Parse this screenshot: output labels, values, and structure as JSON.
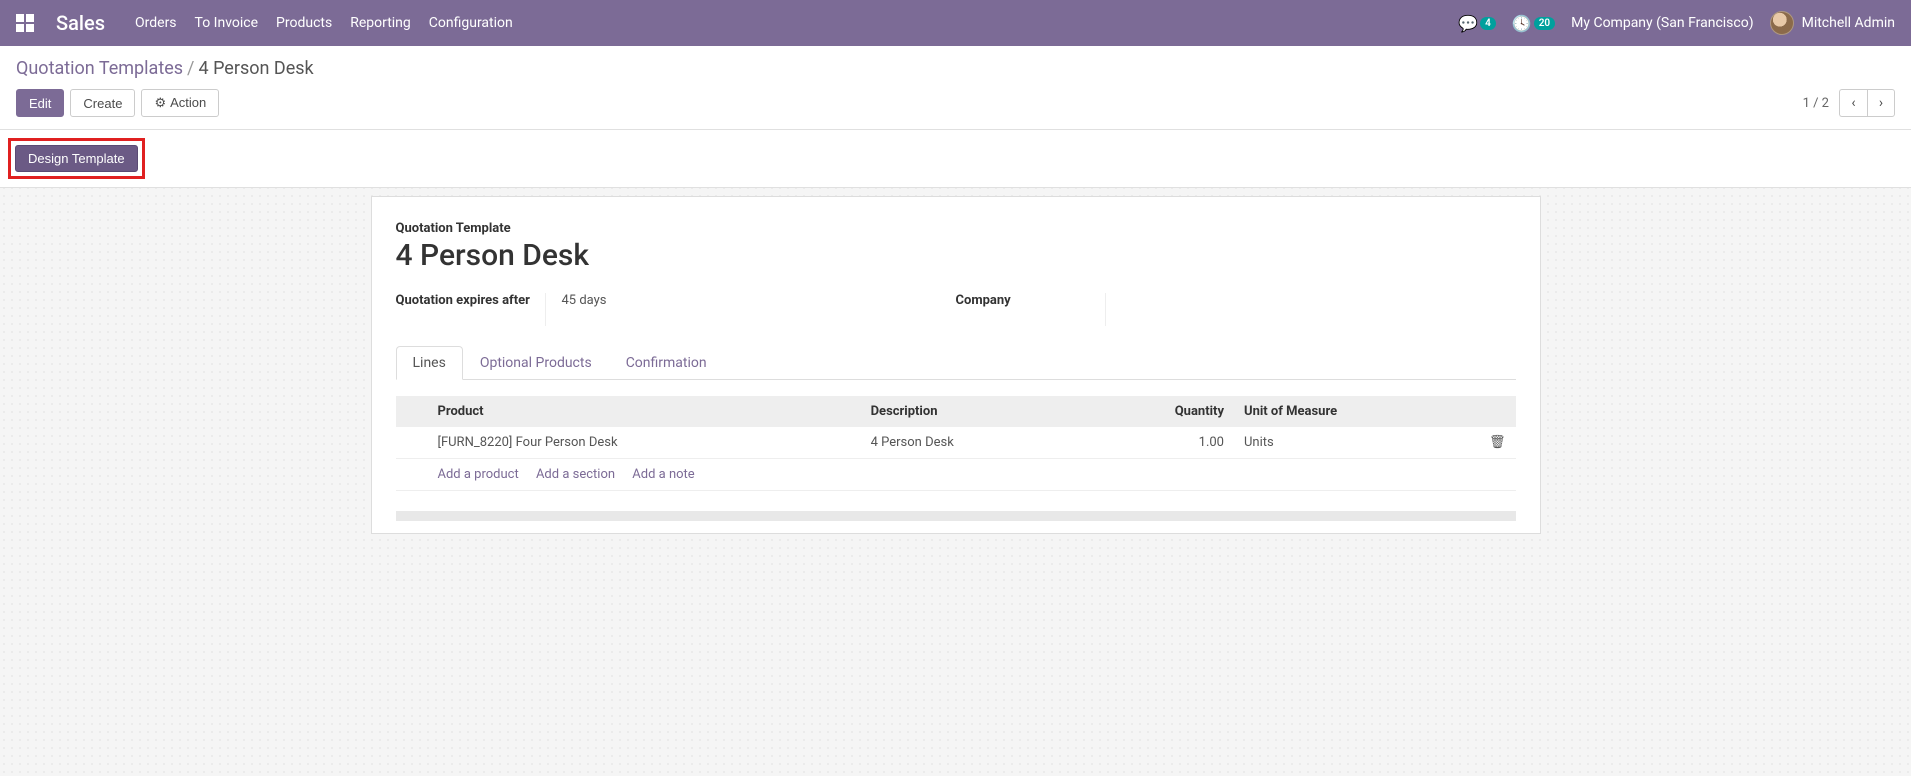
{
  "navbar": {
    "brand": "Sales",
    "menu": [
      "Orders",
      "To Invoice",
      "Products",
      "Reporting",
      "Configuration"
    ],
    "msg_badge": "4",
    "activity_badge": "20",
    "company": "My Company (San Francisco)",
    "user": "Mitchell Admin"
  },
  "breadcrumb": {
    "parent": "Quotation Templates",
    "current": "4 Person Desk"
  },
  "buttons": {
    "edit": "Edit",
    "create": "Create",
    "action": "Action",
    "design_template": "Design Template"
  },
  "pager": {
    "text": "1 / 2"
  },
  "form": {
    "title_label": "Quotation Template",
    "title_value": "4 Person Desk",
    "expiry_label": "Quotation expires after",
    "expiry_value": "45 days",
    "company_label": "Company",
    "company_value": ""
  },
  "tabs": [
    "Lines",
    "Optional Products",
    "Confirmation"
  ],
  "table": {
    "headers": {
      "product": "Product",
      "description": "Description",
      "quantity": "Quantity",
      "uom": "Unit of Measure"
    },
    "rows": [
      {
        "product": "[FURN_8220] Four Person Desk",
        "description": "4 Person Desk",
        "quantity": "1.00",
        "uom": "Units"
      }
    ],
    "add_product": "Add a product",
    "add_section": "Add a section",
    "add_note": "Add a note"
  }
}
